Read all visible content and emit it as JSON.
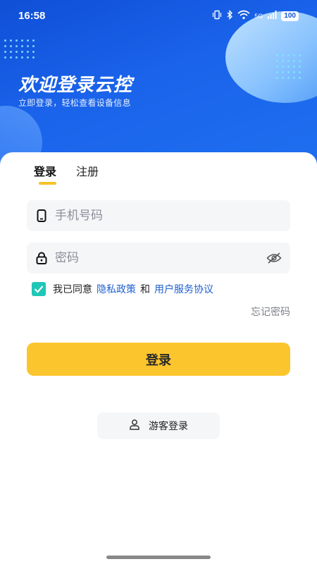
{
  "status_bar": {
    "time": "16:58",
    "network_label": "5G",
    "battery": "100"
  },
  "hero": {
    "title": "欢迎登录云控",
    "subtitle": "立即登录，轻松查看设备信息"
  },
  "tabs": [
    {
      "label": "登录",
      "active": true
    },
    {
      "label": "注册",
      "active": false
    }
  ],
  "form": {
    "phone_placeholder": "手机号码",
    "phone_value": "",
    "password_placeholder": "密码",
    "password_value": "",
    "agree_checked": true,
    "agree_prefix": "我已同意",
    "privacy_link": "隐私政策",
    "and_text": "和",
    "terms_link": "用户服务协议",
    "forgot_password": "忘记密码",
    "login_button": "登录",
    "guest_login": "游客登录"
  },
  "colors": {
    "hero_blue": "#1a63ea",
    "accent_yellow": "#fbc52d",
    "check_teal": "#1fc7b6",
    "link_blue": "#1e5fd0"
  }
}
